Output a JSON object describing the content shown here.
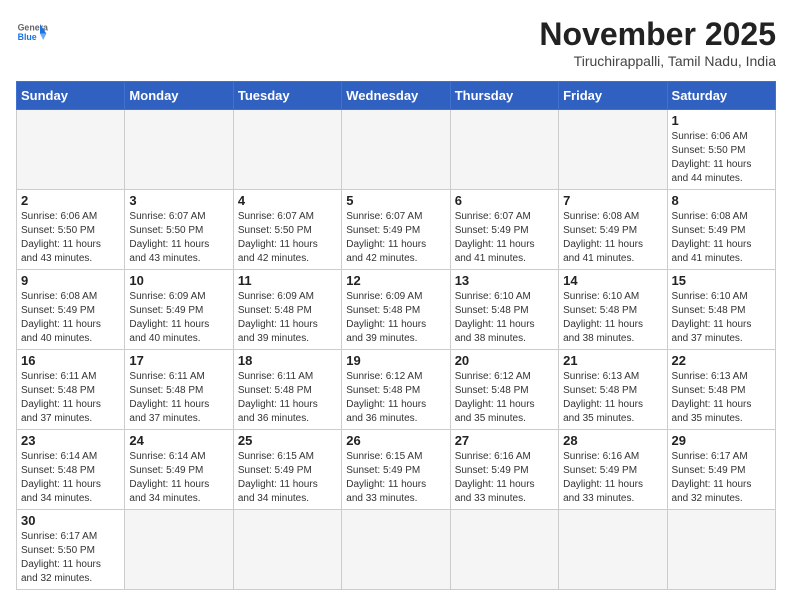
{
  "header": {
    "logo_general": "General",
    "logo_blue": "Blue",
    "month": "November 2025",
    "location": "Tiruchirappalli, Tamil Nadu, India"
  },
  "weekdays": [
    "Sunday",
    "Monday",
    "Tuesday",
    "Wednesday",
    "Thursday",
    "Friday",
    "Saturday"
  ],
  "weeks": [
    [
      {
        "day": "",
        "info": ""
      },
      {
        "day": "",
        "info": ""
      },
      {
        "day": "",
        "info": ""
      },
      {
        "day": "",
        "info": ""
      },
      {
        "day": "",
        "info": ""
      },
      {
        "day": "",
        "info": ""
      },
      {
        "day": "1",
        "info": "Sunrise: 6:06 AM\nSunset: 5:50 PM\nDaylight: 11 hours\nand 44 minutes."
      }
    ],
    [
      {
        "day": "2",
        "info": "Sunrise: 6:06 AM\nSunset: 5:50 PM\nDaylight: 11 hours\nand 43 minutes."
      },
      {
        "day": "3",
        "info": "Sunrise: 6:07 AM\nSunset: 5:50 PM\nDaylight: 11 hours\nand 43 minutes."
      },
      {
        "day": "4",
        "info": "Sunrise: 6:07 AM\nSunset: 5:50 PM\nDaylight: 11 hours\nand 42 minutes."
      },
      {
        "day": "5",
        "info": "Sunrise: 6:07 AM\nSunset: 5:49 PM\nDaylight: 11 hours\nand 42 minutes."
      },
      {
        "day": "6",
        "info": "Sunrise: 6:07 AM\nSunset: 5:49 PM\nDaylight: 11 hours\nand 41 minutes."
      },
      {
        "day": "7",
        "info": "Sunrise: 6:08 AM\nSunset: 5:49 PM\nDaylight: 11 hours\nand 41 minutes."
      },
      {
        "day": "8",
        "info": "Sunrise: 6:08 AM\nSunset: 5:49 PM\nDaylight: 11 hours\nand 41 minutes."
      }
    ],
    [
      {
        "day": "9",
        "info": "Sunrise: 6:08 AM\nSunset: 5:49 PM\nDaylight: 11 hours\nand 40 minutes."
      },
      {
        "day": "10",
        "info": "Sunrise: 6:09 AM\nSunset: 5:49 PM\nDaylight: 11 hours\nand 40 minutes."
      },
      {
        "day": "11",
        "info": "Sunrise: 6:09 AM\nSunset: 5:48 PM\nDaylight: 11 hours\nand 39 minutes."
      },
      {
        "day": "12",
        "info": "Sunrise: 6:09 AM\nSunset: 5:48 PM\nDaylight: 11 hours\nand 39 minutes."
      },
      {
        "day": "13",
        "info": "Sunrise: 6:10 AM\nSunset: 5:48 PM\nDaylight: 11 hours\nand 38 minutes."
      },
      {
        "day": "14",
        "info": "Sunrise: 6:10 AM\nSunset: 5:48 PM\nDaylight: 11 hours\nand 38 minutes."
      },
      {
        "day": "15",
        "info": "Sunrise: 6:10 AM\nSunset: 5:48 PM\nDaylight: 11 hours\nand 37 minutes."
      }
    ],
    [
      {
        "day": "16",
        "info": "Sunrise: 6:11 AM\nSunset: 5:48 PM\nDaylight: 11 hours\nand 37 minutes."
      },
      {
        "day": "17",
        "info": "Sunrise: 6:11 AM\nSunset: 5:48 PM\nDaylight: 11 hours\nand 37 minutes."
      },
      {
        "day": "18",
        "info": "Sunrise: 6:11 AM\nSunset: 5:48 PM\nDaylight: 11 hours\nand 36 minutes."
      },
      {
        "day": "19",
        "info": "Sunrise: 6:12 AM\nSunset: 5:48 PM\nDaylight: 11 hours\nand 36 minutes."
      },
      {
        "day": "20",
        "info": "Sunrise: 6:12 AM\nSunset: 5:48 PM\nDaylight: 11 hours\nand 35 minutes."
      },
      {
        "day": "21",
        "info": "Sunrise: 6:13 AM\nSunset: 5:48 PM\nDaylight: 11 hours\nand 35 minutes."
      },
      {
        "day": "22",
        "info": "Sunrise: 6:13 AM\nSunset: 5:48 PM\nDaylight: 11 hours\nand 35 minutes."
      }
    ],
    [
      {
        "day": "23",
        "info": "Sunrise: 6:14 AM\nSunset: 5:48 PM\nDaylight: 11 hours\nand 34 minutes."
      },
      {
        "day": "24",
        "info": "Sunrise: 6:14 AM\nSunset: 5:49 PM\nDaylight: 11 hours\nand 34 minutes."
      },
      {
        "day": "25",
        "info": "Sunrise: 6:15 AM\nSunset: 5:49 PM\nDaylight: 11 hours\nand 34 minutes."
      },
      {
        "day": "26",
        "info": "Sunrise: 6:15 AM\nSunset: 5:49 PM\nDaylight: 11 hours\nand 33 minutes."
      },
      {
        "day": "27",
        "info": "Sunrise: 6:16 AM\nSunset: 5:49 PM\nDaylight: 11 hours\nand 33 minutes."
      },
      {
        "day": "28",
        "info": "Sunrise: 6:16 AM\nSunset: 5:49 PM\nDaylight: 11 hours\nand 33 minutes."
      },
      {
        "day": "29",
        "info": "Sunrise: 6:17 AM\nSunset: 5:49 PM\nDaylight: 11 hours\nand 32 minutes."
      }
    ],
    [
      {
        "day": "30",
        "info": "Sunrise: 6:17 AM\nSunset: 5:50 PM\nDaylight: 11 hours\nand 32 minutes."
      },
      {
        "day": "",
        "info": ""
      },
      {
        "day": "",
        "info": ""
      },
      {
        "day": "",
        "info": ""
      },
      {
        "day": "",
        "info": ""
      },
      {
        "day": "",
        "info": ""
      },
      {
        "day": "",
        "info": ""
      }
    ]
  ]
}
